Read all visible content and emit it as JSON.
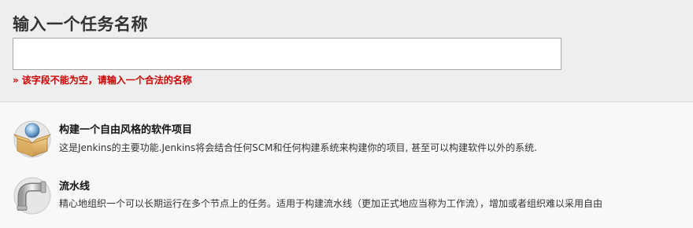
{
  "header": {
    "title": "输入一个任务名称",
    "name_input_value": "",
    "error_arrow": "»",
    "error_message": "该字段不能为空，请输入一个合法的名称"
  },
  "job_types": [
    {
      "icon": "freestyle-project-icon",
      "title": "构建一个自由风格的软件项目",
      "description": "这是Jenkins的主要功能.Jenkins将会结合任何SCM和任何构建系统来构建你的项目, 甚至可以构建软件以外的系统."
    },
    {
      "icon": "pipeline-icon",
      "title": "流水线",
      "description": "精心地组织一个可以长期运行在多个节点上的任务。适用于构建流水线（更加正式地应当称为工作流），增加或者组织难以采用自由"
    }
  ],
  "colors": {
    "error": "#cc0000",
    "header_bg": "#eeeeee",
    "page_bg": "#f8f8f8"
  }
}
